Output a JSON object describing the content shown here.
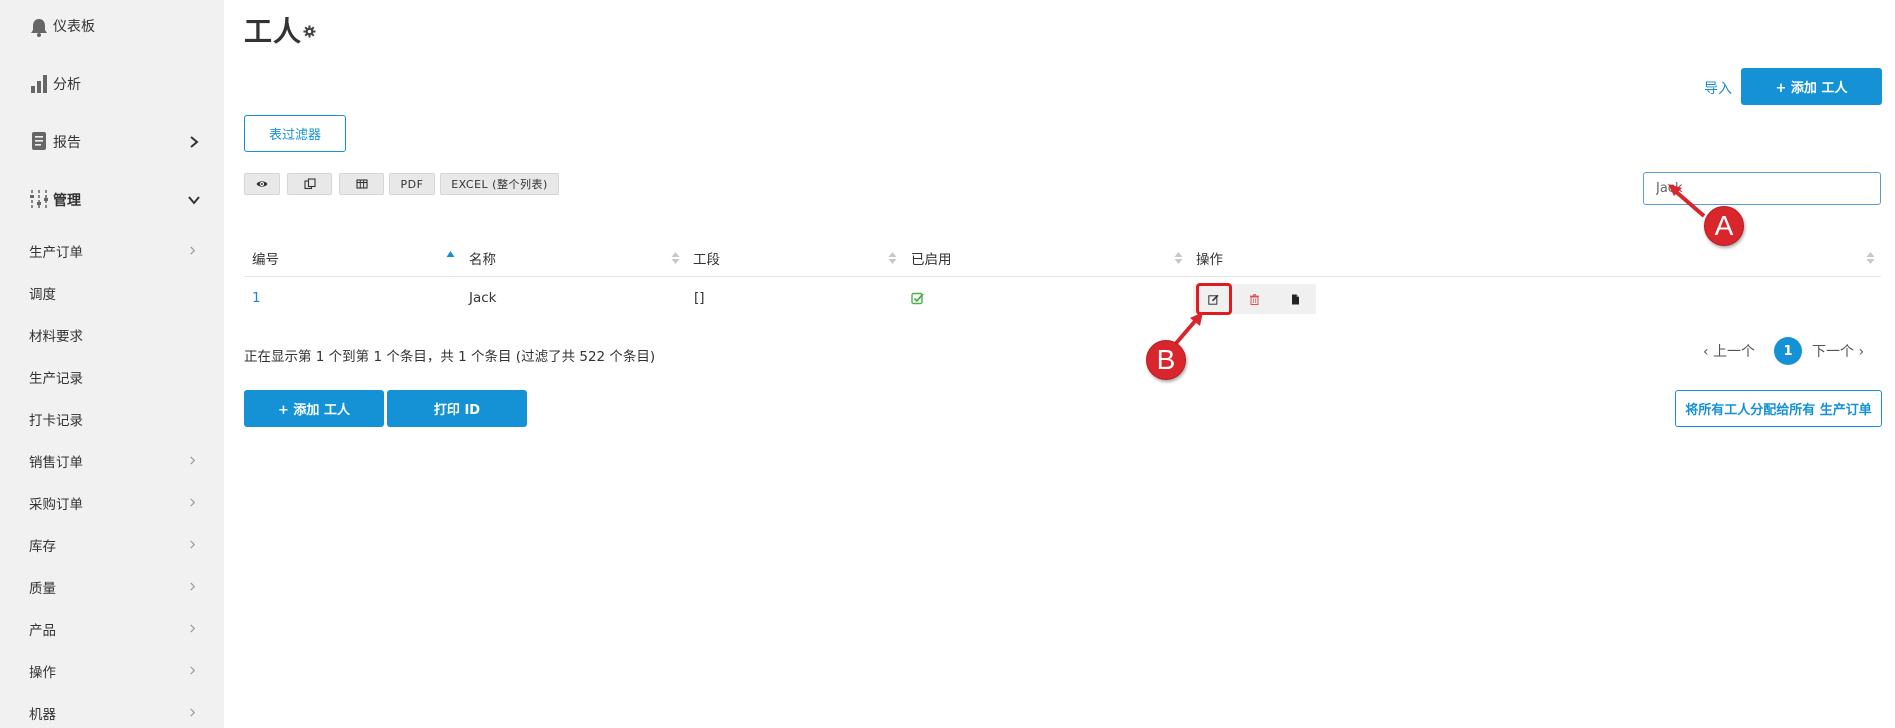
{
  "sidebar": {
    "top_items": [
      {
        "label": "仪表板",
        "icon": "bell-icon"
      },
      {
        "label": "分析",
        "icon": "bar-chart-icon"
      },
      {
        "label": "报告",
        "icon": "report-icon"
      },
      {
        "label": "管理",
        "icon": "sliders-icon"
      }
    ],
    "sub_items": [
      {
        "label": "生产订单",
        "has_submenu": true
      },
      {
        "label": "调度",
        "has_submenu": false
      },
      {
        "label": "材料要求",
        "has_submenu": false
      },
      {
        "label": "生产记录",
        "has_submenu": false
      },
      {
        "label": "打卡记录",
        "has_submenu": false
      },
      {
        "label": "销售订单",
        "has_submenu": true
      },
      {
        "label": "采购订单",
        "has_submenu": true
      },
      {
        "label": "库存",
        "has_submenu": true
      },
      {
        "label": "质量",
        "has_submenu": true
      },
      {
        "label": "产品",
        "has_submenu": true
      },
      {
        "label": "操作",
        "has_submenu": true
      },
      {
        "label": "机器",
        "has_submenu": true
      }
    ]
  },
  "page": {
    "title": "工人",
    "import_label": "导入",
    "add_worker_label": "+ 添加 工人",
    "filter_label": "表过滤器"
  },
  "toolbar": {
    "pdf_label": "PDF",
    "excel_label": "EXCEL (整个列表)"
  },
  "search": {
    "value": "Jack"
  },
  "table": {
    "columns": [
      "编号",
      "名称",
      "工段",
      "已启用",
      "操作"
    ],
    "rows": [
      {
        "id": "1",
        "name": "Jack",
        "section": "[]",
        "enabled": true
      }
    ]
  },
  "info": {
    "text": "正在显示第 1 个到第 1 个条目，共 1 个条目 (过滤了共 522 个条目)"
  },
  "pagination": {
    "prev_label": "‹ 上一个",
    "current": "1",
    "next_label": "下一个 ›"
  },
  "footer": {
    "add_worker_label": "+ 添加 工人",
    "print_id_label": "打印 ID",
    "assign_all_label": "将所有工人分配给所有 生产订单"
  },
  "callouts": {
    "a": "A",
    "b": "B"
  },
  "colors": {
    "accent": "#1592d6",
    "callout": "#d9262c",
    "enabled_check": "#4caf50",
    "delete": "#e05050"
  }
}
